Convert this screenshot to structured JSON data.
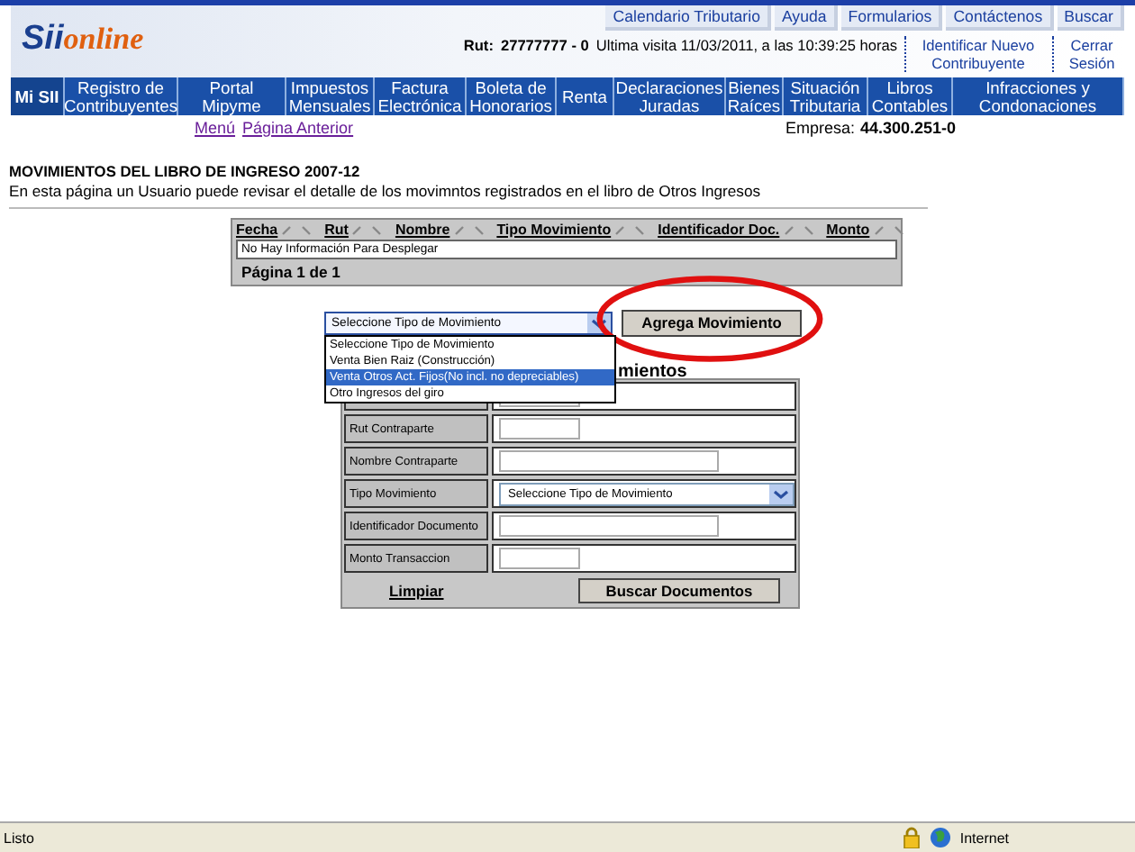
{
  "header": {
    "logo_main": "Sii",
    "logo_accent": "online",
    "top_links": [
      "Calendario Tributario",
      "Ayuda",
      "Formularios",
      "Contáctenos",
      "Buscar"
    ],
    "rut_label": "Rut:",
    "rut_value": "27777777 - 0",
    "last_visit": "Ultima visita 11/03/2011, a las 10:39:25 horas",
    "side_links": [
      "Identificar Nuevo Contribuyente",
      "Cerrar Sesión"
    ]
  },
  "nav": [
    {
      "label": "Mi SII",
      "selected": true
    },
    {
      "label": "Registro de Contribuyentes",
      "selected": false
    },
    {
      "label": "Portal Mipyme",
      "selected": false
    },
    {
      "label": "Impuestos Mensuales",
      "selected": false
    },
    {
      "label": "Factura Electrónica",
      "selected": false
    },
    {
      "label": "Boleta de Honorarios",
      "selected": false
    },
    {
      "label": "Renta",
      "selected": false
    },
    {
      "label": "Declaraciones Juradas",
      "selected": false
    },
    {
      "label": "Bienes Raíces",
      "selected": false
    },
    {
      "label": "Situación Tributaria",
      "selected": false
    },
    {
      "label": "Libros Contables",
      "selected": false
    },
    {
      "label": "Infracciones y Condonaciones",
      "selected": false
    }
  ],
  "subnav": {
    "links": [
      "Menú",
      "Página Anterior"
    ],
    "empresa_label": "Empresa:",
    "empresa_value": "44.300.251-0"
  },
  "page": {
    "title": "MOVIMIENTOS DEL LIBRO DE INGRESO 2007-12",
    "description": "En esta página un Usuario puede revisar el detalle de los movimntos registrados en el libro de Otros Ingresos"
  },
  "grid": {
    "columns": [
      "Fecha",
      "Rut",
      "Nombre",
      "Tipo Movimiento",
      "Identificador Doc.",
      "Monto"
    ],
    "empty_message": "No Hay Información Para Desplegar",
    "pager": "Página 1 de 1"
  },
  "type_select": {
    "value": "Seleccione Tipo de Movimiento",
    "expanded": true,
    "options": [
      {
        "label": "Seleccione Tipo de Movimiento",
        "highlighted": false
      },
      {
        "label": "Venta Bien Raiz (Construcción)",
        "highlighted": false
      },
      {
        "label": "Venta Otros Act. Fijos(No incl. no depreciables)",
        "highlighted": true
      },
      {
        "label": "Otro Ingresos del giro",
        "highlighted": false
      }
    ]
  },
  "add_button": "Agrega Movimiento",
  "form": {
    "heading_visible": "mientos",
    "rows": [
      {
        "kind": "short"
      },
      {
        "kind": "short",
        "label": "Rut Contraparte"
      },
      {
        "kind": "long",
        "label": "Nombre Contraparte"
      },
      {
        "kind": "select",
        "label": "Tipo Movimiento",
        "value": "Seleccione Tipo de Movimiento"
      },
      {
        "kind": "long",
        "label": "Identificador Documento"
      },
      {
        "kind": "short",
        "label": "Monto Transaccion"
      }
    ],
    "clear_link": "Limpiar",
    "search_button": "Buscar Documentos"
  },
  "status_bar": {
    "text": "Listo",
    "zone": "Internet"
  }
}
